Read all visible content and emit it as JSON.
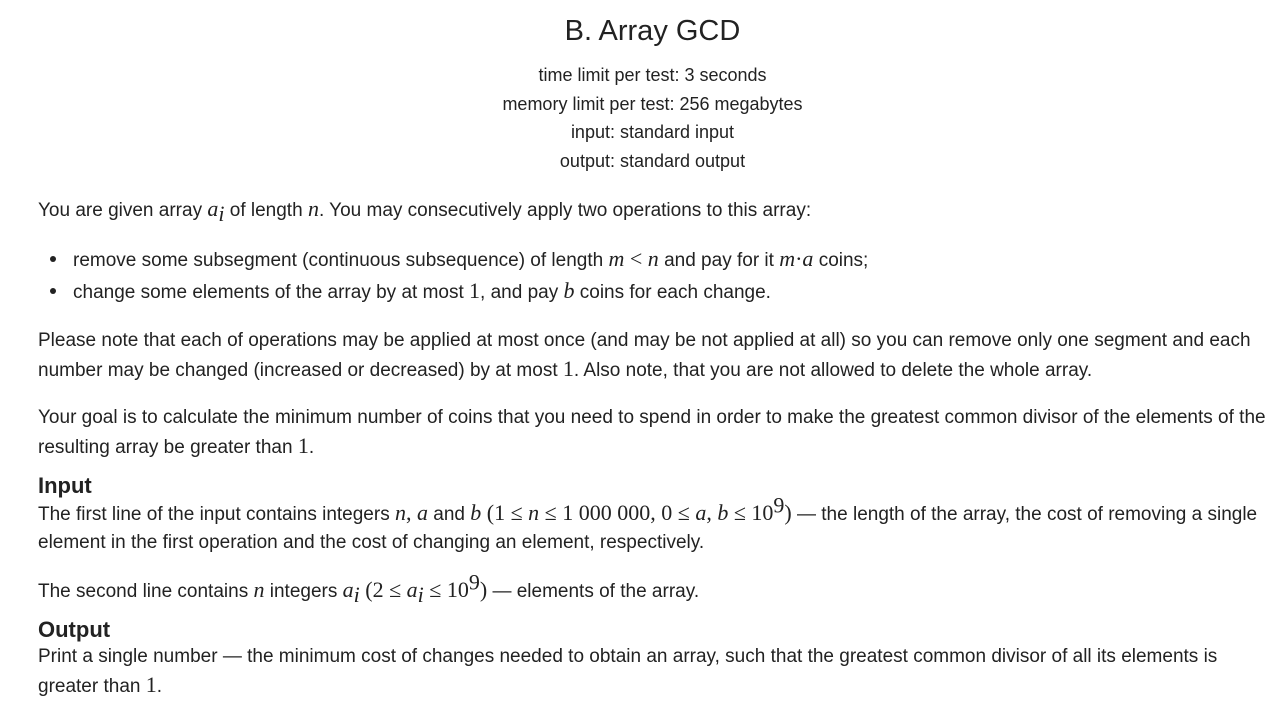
{
  "problem": {
    "title": "B. Array GCD",
    "time_limit": "time limit per test: 3 seconds",
    "memory_limit": "memory limit per test: 256 megabytes",
    "input_file": "input: standard input",
    "output_file": "output: standard output"
  },
  "statement": {
    "p1_a": "You are given array ",
    "p1_b": " of length ",
    "p1_c": ". You may consecutively apply two operations to this array:",
    "bullet1_a": "remove some subsegment (continuous subsequence) of length ",
    "bullet1_b": " and pay for it ",
    "bullet1_c": " coins;",
    "bullet2_a": "change some elements of the array by at most ",
    "bullet2_b": ", and pay ",
    "bullet2_c": " coins for each change.",
    "p2_a": "Please note that each of operations may be applied at most once (and may be not applied at all) so you can remove only one segment and each number may be changed (increased or decreased) by at most ",
    "p2_b": ". Also note, that you are not allowed to delete the whole array.",
    "p3_a": "Your goal is to calculate the minimum number of coins that you need to spend in order to make the greatest common divisor of the elements of the resulting array be greater than ",
    "p3_b": "."
  },
  "input_section": {
    "title": "Input",
    "l1_a": "The first line of the input contains integers ",
    "l1_b": " and ",
    "l1_c": " — the length of the array, the cost of removing a single element in the first operation and the cost of changing an element, respectively.",
    "l2_a": "The second line contains ",
    "l2_b": " integers ",
    "l2_c": " — elements of the array."
  },
  "output_section": {
    "title": "Output",
    "l1_a": "Print a single number — the minimum cost of changes needed to obtain an array, such that the greatest common divisor of all its elements is greater than ",
    "l1_b": "."
  },
  "math": {
    "a": "a",
    "i": "i",
    "n": "n",
    "m": "m",
    "lt": " < ",
    "dot": "·",
    "b": "b",
    "one": "1",
    "comma": ", ",
    "paren_open": " (",
    "le": " ≤ ",
    "million": "1 000 000",
    "zero": "0",
    "ten": "10",
    "nine": "9",
    "paren_close": ")",
    "two": "2"
  }
}
